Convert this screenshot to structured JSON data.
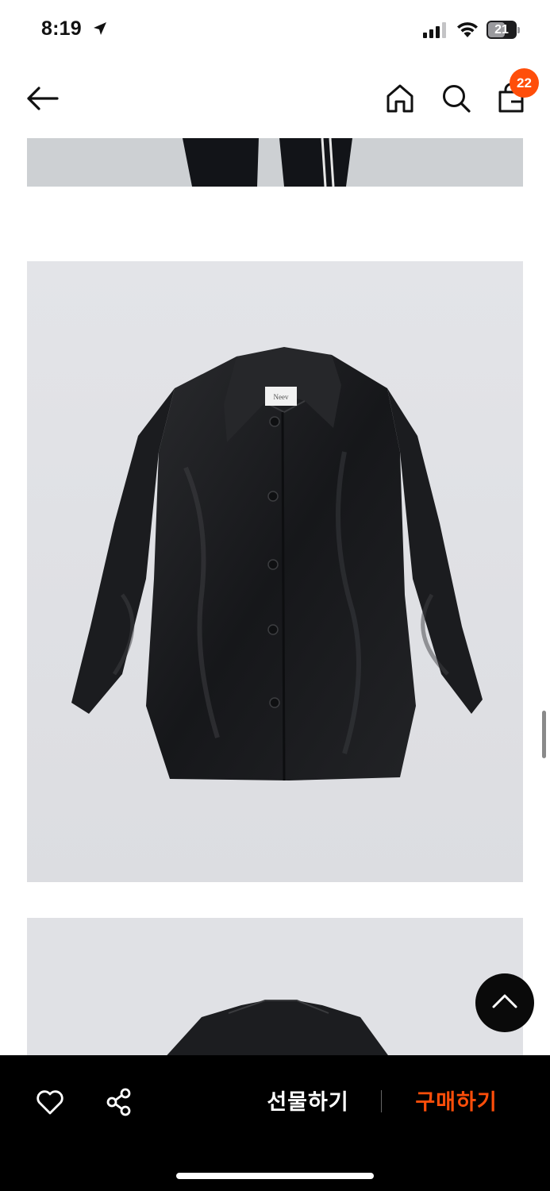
{
  "status_bar": {
    "time": "8:19",
    "battery": "21",
    "icons": [
      "location-arrow-icon",
      "cellular-signal-icon",
      "wifi-icon",
      "battery-icon"
    ]
  },
  "nav": {
    "icons": [
      "back-arrow-icon",
      "home-icon",
      "search-icon",
      "shopping-bag-icon"
    ],
    "cart_count": "22"
  },
  "product_images": {
    "main_label_text": "Neev"
  },
  "bottom_bar": {
    "gift_label": "선물하기",
    "buy_label": "구매하기",
    "icons": [
      "heart-icon",
      "share-icon"
    ]
  },
  "colors": {
    "accent": "#ff4e0a",
    "bar_background": "#000000",
    "image_background": "#dfe0e4"
  }
}
